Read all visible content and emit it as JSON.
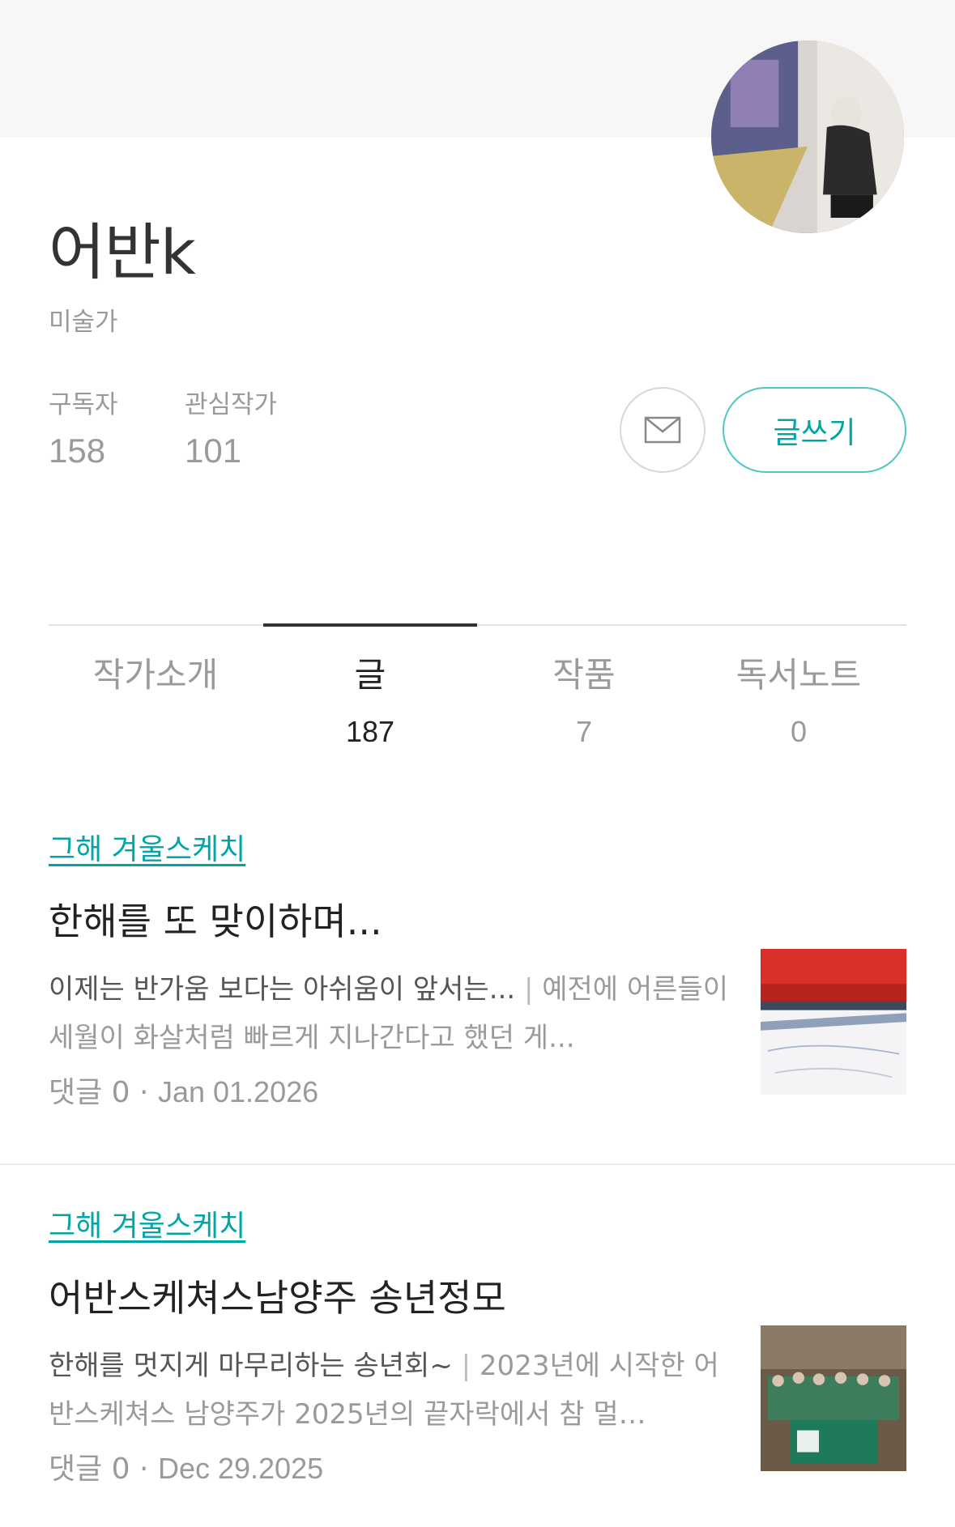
{
  "profile": {
    "name": "어반k",
    "job": "미술가",
    "subscribers_label": "구독자",
    "subscribers_count": "158",
    "following_label": "관심작가",
    "following_count": "101",
    "write_label": "글쓰기",
    "message_icon": "envelope-icon",
    "avatar": "profile-photo"
  },
  "tabs": [
    {
      "label": "작가소개",
      "count": ""
    },
    {
      "label": "글",
      "count": "187",
      "active": true
    },
    {
      "label": "작품",
      "count": "7"
    },
    {
      "label": "독서노트",
      "count": "0"
    }
  ],
  "posts": [
    {
      "category": "그해 겨울스케치",
      "title": "한해를 또 맞이하며...",
      "excerpt_lead": "이제는 반가움 보다는 아쉬움이 앞서는... ",
      "excerpt_sep": "|",
      "excerpt_body": " 예전에 어른들이 세월이 화살처럼 빠르게 지나간다고 했던 게...",
      "comments": "댓글 0",
      "dot": "·",
      "date": "Jan 01.2026"
    },
    {
      "category": "그해 겨울스케치",
      "title": "어반스케쳐스남양주 송년정모",
      "excerpt_lead": "한해를 멋지게 마무리하는 송년회~ ",
      "excerpt_sep": "|",
      "excerpt_body": " 2023년에 시작한 어반스케쳐스 남양주가 2025년의 끝자락에서 참 멀…",
      "comments": "댓글 0",
      "dot": "·",
      "date": "Dec 29.2025"
    }
  ],
  "colors": {
    "accent": "#00a5a5",
    "text": "#222222",
    "muted": "#9a9a9a",
    "band": "#f7f7f7"
  }
}
